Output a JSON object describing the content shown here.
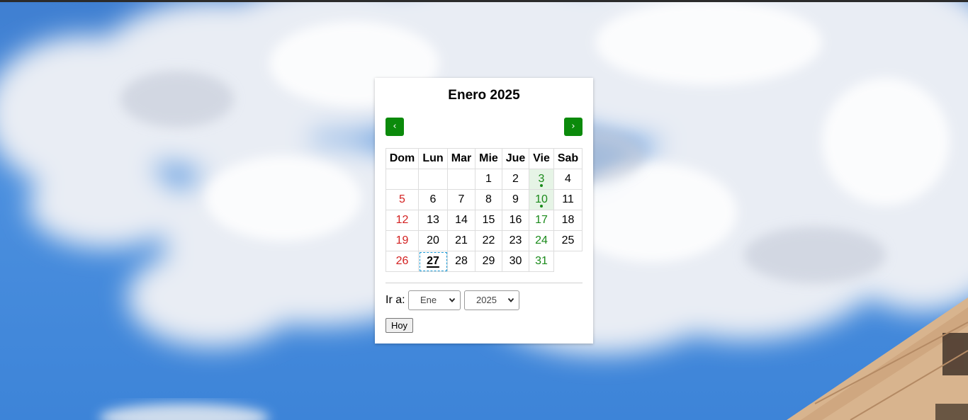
{
  "calendar": {
    "title": "Enero 2025",
    "prev_label": "‹",
    "next_label": "›",
    "weekdays": [
      "Dom",
      "Lun",
      "Mar",
      "Mie",
      "Jue",
      "Vie",
      "Sab"
    ],
    "weeks": [
      [
        "",
        "",
        "",
        "1",
        "2",
        "3",
        "4"
      ],
      [
        "5",
        "6",
        "7",
        "8",
        "9",
        "10",
        "11"
      ],
      [
        "12",
        "13",
        "14",
        "15",
        "16",
        "17",
        "18"
      ],
      [
        "19",
        "20",
        "21",
        "22",
        "23",
        "24",
        "25"
      ],
      [
        "26",
        "27",
        "28",
        "29",
        "30",
        "31",
        ""
      ]
    ],
    "event_days": [
      "3",
      "10"
    ],
    "today": "27",
    "colors": {
      "accent": "#0b8a0b",
      "sunday": "#d32020",
      "friday": "#1a8a1a",
      "event_bg": "#e6f4e6",
      "today_outline": "#1a9ad6"
    }
  },
  "goto": {
    "label": "Ir a:",
    "month_selected": "Ene",
    "year_selected": "2025",
    "today_button": "Hoy"
  },
  "icons": {
    "prev": "chevron-left-icon",
    "next": "chevron-right-icon",
    "select_arrow": "chevron-down-icon"
  }
}
